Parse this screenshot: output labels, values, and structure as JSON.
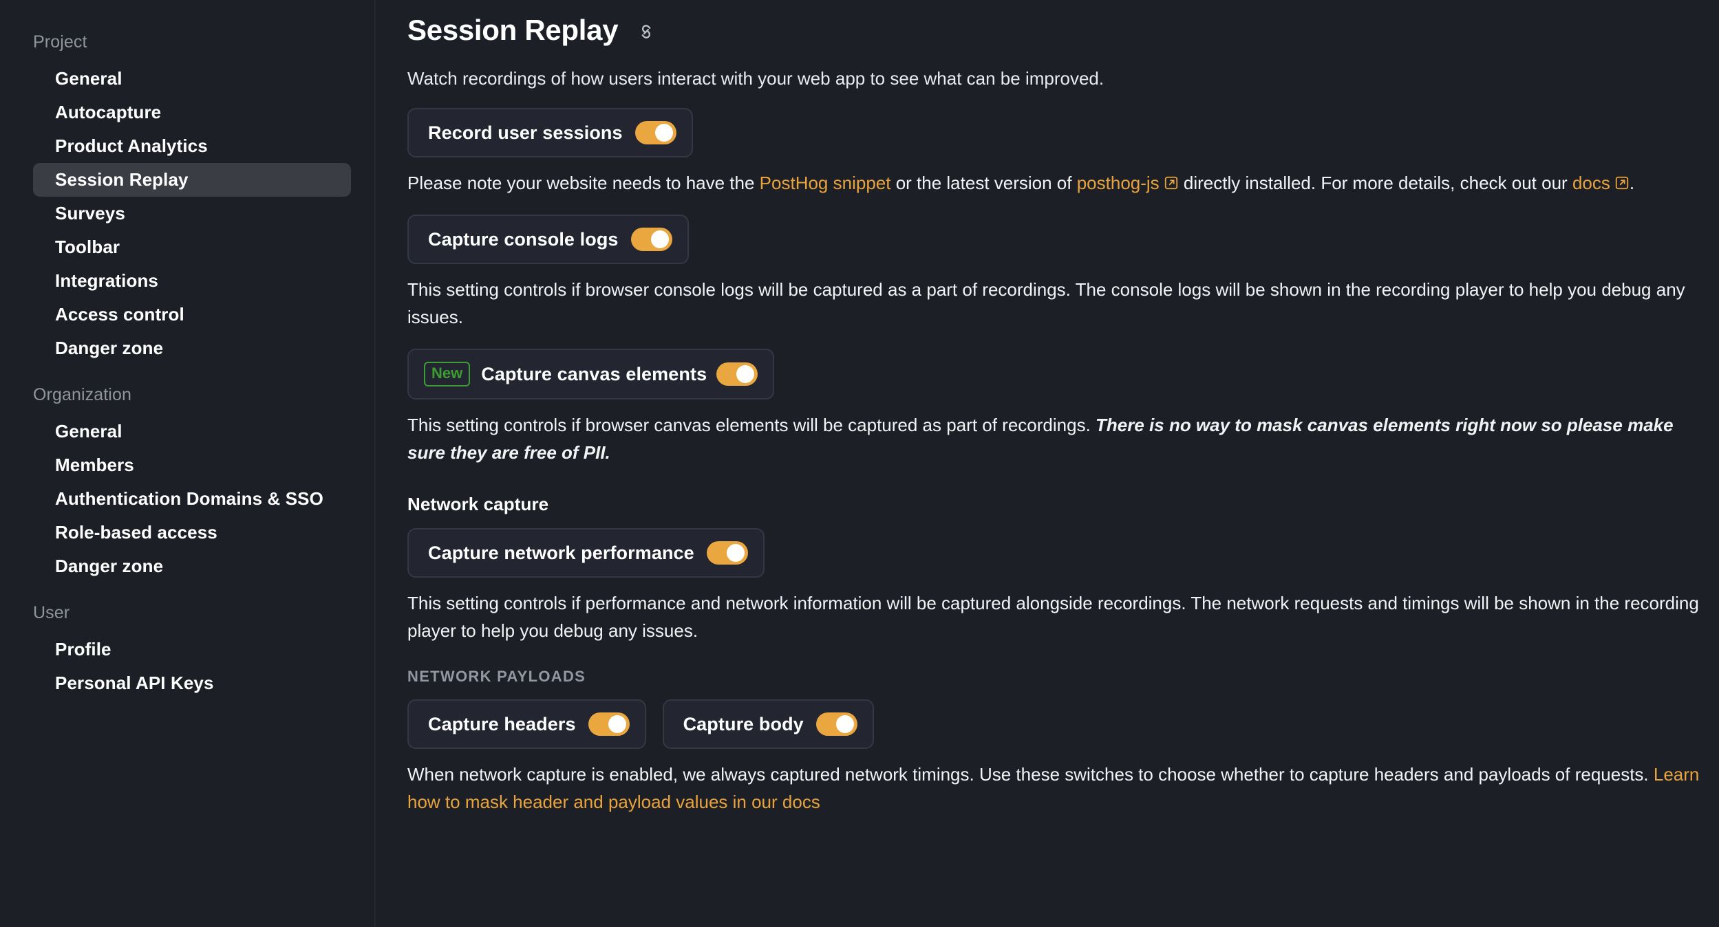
{
  "sidebar": {
    "sections": [
      {
        "label": "Project",
        "items": [
          {
            "label": "General",
            "active": false
          },
          {
            "label": "Autocapture",
            "active": false
          },
          {
            "label": "Product Analytics",
            "active": false
          },
          {
            "label": "Session Replay",
            "active": true
          },
          {
            "label": "Surveys",
            "active": false
          },
          {
            "label": "Toolbar",
            "active": false
          },
          {
            "label": "Integrations",
            "active": false
          },
          {
            "label": "Access control",
            "active": false
          },
          {
            "label": "Danger zone",
            "active": false
          }
        ]
      },
      {
        "label": "Organization",
        "items": [
          {
            "label": "General",
            "active": false
          },
          {
            "label": "Members",
            "active": false
          },
          {
            "label": "Authentication Domains & SSO",
            "active": false
          },
          {
            "label": "Role-based access",
            "active": false
          },
          {
            "label": "Danger zone",
            "active": false
          }
        ]
      },
      {
        "label": "User",
        "items": [
          {
            "label": "Profile",
            "active": false
          },
          {
            "label": "Personal API Keys",
            "active": false
          }
        ]
      }
    ]
  },
  "main": {
    "title": "Session Replay",
    "anchor_icon": "link-icon",
    "subtitle": "Watch recordings of how users interact with your web app to see what can be improved.",
    "record_sessions": {
      "label": "Record user sessions",
      "toggle_state": "on"
    },
    "snippet_note": {
      "prefix": "Please note your website needs to have the ",
      "link1": "PostHog snippet",
      "mid1": " or the latest version of ",
      "link2": "posthog-js",
      "mid2": " directly installed. For more details, check out our ",
      "link3": "docs",
      "suffix": "."
    },
    "console_logs": {
      "label": "Capture console logs",
      "toggle_state": "on",
      "description": "This setting controls if browser console logs will be captured as a part of recordings. The console logs will be shown in the recording player to help you debug any issues."
    },
    "canvas": {
      "badge": "New",
      "label": "Capture canvas elements",
      "toggle_state": "on",
      "description_plain": "This setting controls if browser canvas elements will be captured as part of recordings. ",
      "description_emphasis": "There is no way to mask canvas elements right now so please make sure they are free of PII."
    },
    "network": {
      "heading": "Network capture",
      "performance": {
        "label": "Capture network performance",
        "toggle_state": "on"
      },
      "description": "This setting controls if performance and network information will be captured alongside recordings. The network requests and timings will be shown in the recording player to help you debug any issues.",
      "payloads_label": "NETWORK PAYLOADS",
      "headers": {
        "label": "Capture headers",
        "toggle_state": "on"
      },
      "body": {
        "label": "Capture body",
        "toggle_state": "on"
      },
      "footer": {
        "text": "When network capture is enabled, we always captured network timings. Use these switches to choose whether to capture headers and payloads of requests. ",
        "link": "Learn how to mask header and payload values in our docs"
      }
    }
  },
  "colors": {
    "background": "#1d1f27",
    "accent_amber": "#e8a33d",
    "toggle_on": "#eaa73f",
    "badge_green": "#3f9c35",
    "card_bg": "#232630",
    "card_border": "#343842",
    "active_nav": "#3a3d44",
    "muted_text": "#8f949e"
  }
}
